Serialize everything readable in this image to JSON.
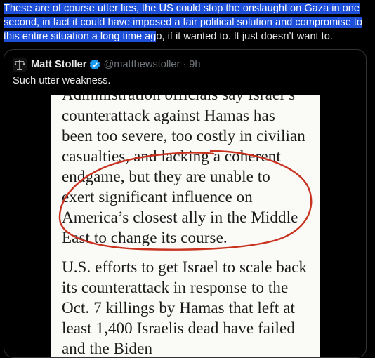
{
  "post": {
    "highlighted_text": "These are of course utter lies, the US could stop the onslaught on Gaza in one second, in fact it could have imposed a fair political solution and compromise to this entire situation a long time ag",
    "plain_text": "o, if it wanted to. It just doesn’t want to."
  },
  "quote": {
    "author_name": "Matt Stoller",
    "handle": "@matthewstoller",
    "separator": "·",
    "time": "9h",
    "text": "Such utter weakness.",
    "avatar_icon": "scales-of-justice-icon",
    "verified_icon": "verified-badge-icon",
    "verified_color": "#1d9bf0"
  },
  "article": {
    "cut_line": "Administration officials say Israel’s",
    "lines": [
      "counterattack against Hamas has",
      "been too severe, too costly in civilian",
      "casualties, and lacking a coherent",
      "endgame, but they are unable to",
      "exert significant influence on",
      "America’s closest ally in the Middle",
      "East to change its course.",
      "U.S. efforts to get Israel to scale back",
      "its counterattack in response to the",
      "Oct. 7 killings by Hamas that left at",
      "least 1,400 Israelis dead have failed",
      "and the Biden"
    ],
    "annotation_color": "#c8321f",
    "selection_color": "#1d4fd8"
  }
}
